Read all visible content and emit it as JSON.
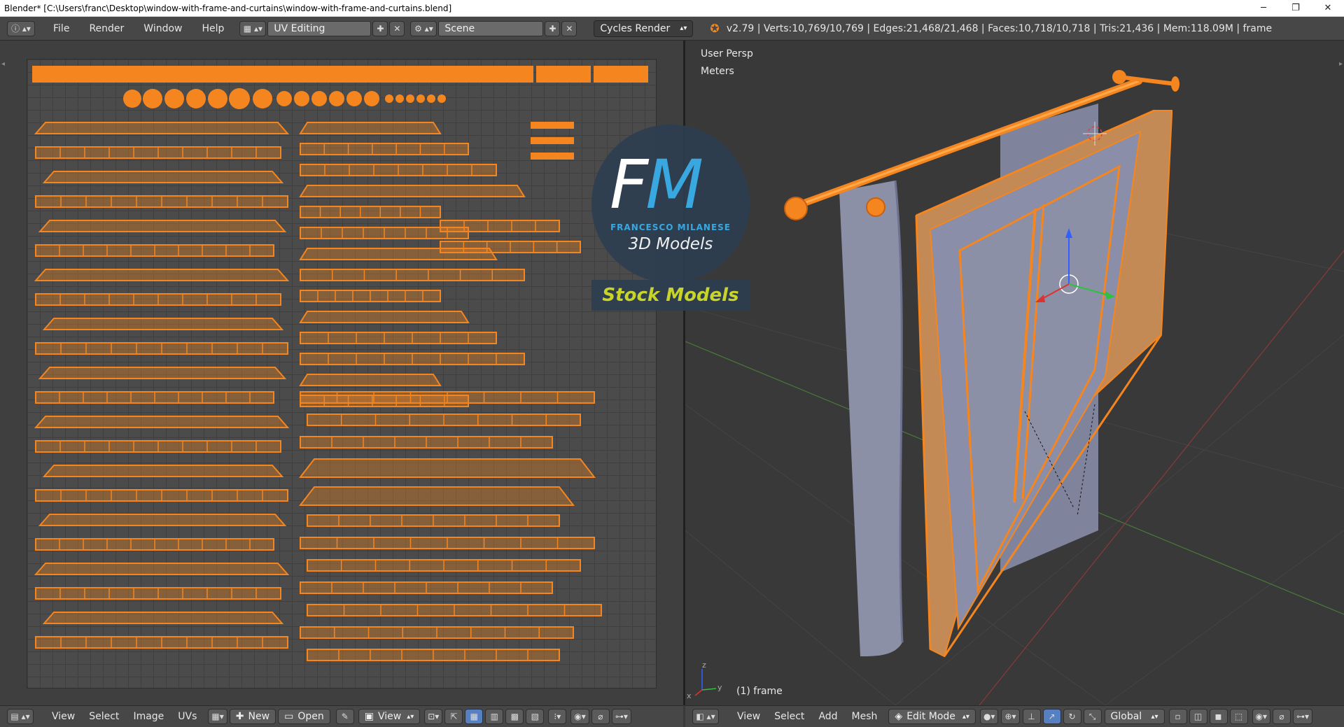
{
  "window": {
    "title": "Blender* [C:\\Users\\franc\\Desktop\\window-with-frame-and-curtains\\window-with-frame-and-curtains.blend]",
    "minimize": "─",
    "maximize": "❐",
    "close": "✕"
  },
  "info_header": {
    "menus": [
      "File",
      "Render",
      "Window",
      "Help"
    ],
    "screen_layout": "UV Editing",
    "scene": "Scene",
    "render_engine": "Cycles Render",
    "stats": "v2.79 | Verts:10,769/10,769 | Edges:21,468/21,468 | Faces:10,718/10,718 | Tris:21,436 | Mem:118.09M | frame"
  },
  "viewport": {
    "view_name": "User Persp",
    "units": "Meters",
    "object_label": "(1) frame",
    "axis_x": "x",
    "axis_y": "y",
    "axis_z": "z"
  },
  "watermark": {
    "initial_f": "F",
    "initial_m": "M",
    "name": "FRANCESCO MILANESE",
    "subtitle": "3D Models",
    "banner": "Stock Models"
  },
  "uv_header": {
    "menus": [
      "View",
      "Select",
      "Image",
      "UVs"
    ],
    "new_label": "New",
    "open_label": "Open",
    "view_label": "View"
  },
  "view3d_header": {
    "menus": [
      "View",
      "Select",
      "Add",
      "Mesh"
    ],
    "mode": "Edit Mode",
    "orientation": "Global"
  },
  "colors": {
    "accent_orange": "#f5861f",
    "blender_header": "#474747",
    "curtain": "#8c90a6",
    "watermark_blue": "#39a8e0",
    "watermark_green": "#c8d428"
  }
}
